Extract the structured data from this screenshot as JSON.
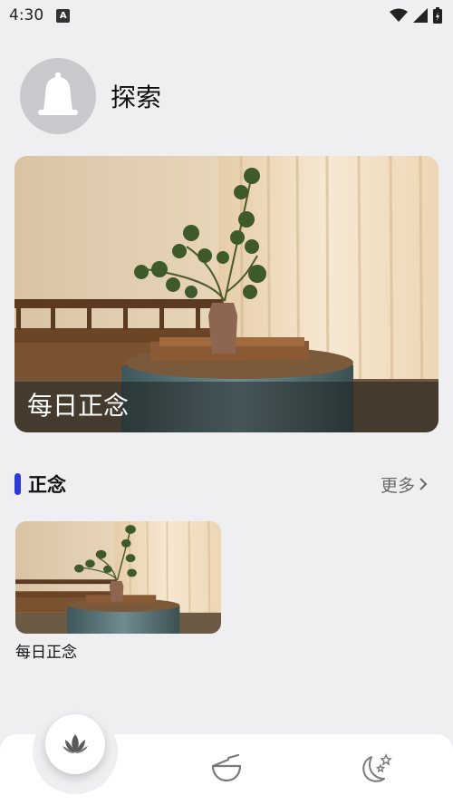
{
  "status_bar": {
    "time": "4:30",
    "app_icon": "A"
  },
  "header": {
    "title": "探索",
    "avatar_icon": "bell-icon"
  },
  "hero": {
    "caption": "每日正念"
  },
  "section": {
    "title": "正念",
    "more_label": "更多"
  },
  "cards": [
    {
      "label": "每日正念"
    }
  ],
  "bottom_nav": {
    "items": [
      "lotus-icon",
      "bowl-icon",
      "moon-stars-icon"
    ]
  },
  "colors": {
    "accent": "#2b39d6",
    "background": "#efeef1",
    "avatar": "#c8c8cd"
  }
}
